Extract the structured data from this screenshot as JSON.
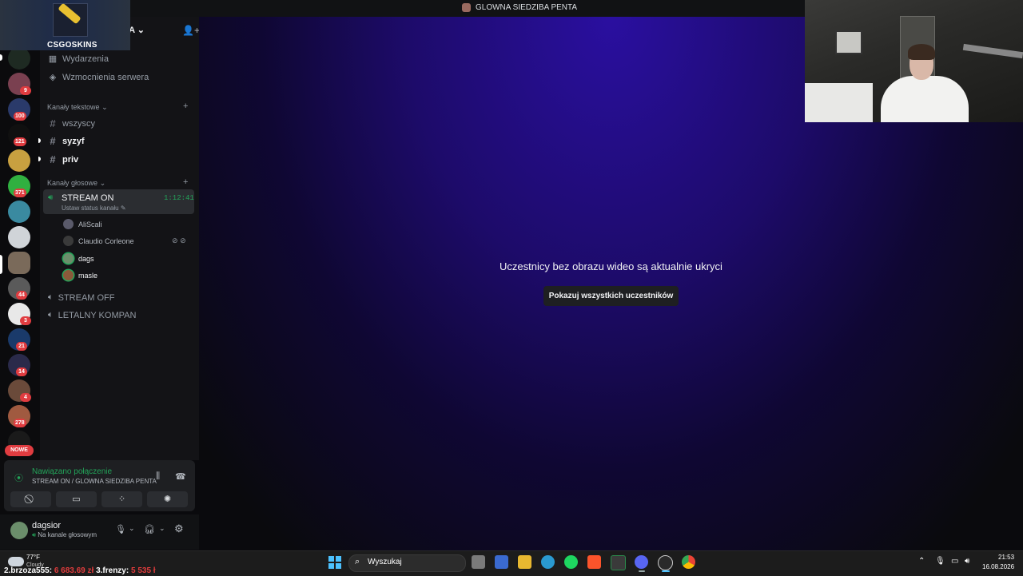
{
  "window": {
    "title": "GLOWNA SIEDZIBA PENTA"
  },
  "promo": {
    "brand": "CSGOSKINS"
  },
  "server": {
    "name_visible": "ENTA"
  },
  "server_rail": {
    "badges": [
      "9",
      "100",
      "121",
      "371",
      "44",
      "3",
      "21",
      "14",
      "4",
      "278"
    ],
    "new_label": "NOWE"
  },
  "sidebar": {
    "top_items": [
      {
        "label": "Wydarzenia",
        "icon": "calendar-icon"
      },
      {
        "label": "Wzmocnienia serwera",
        "icon": "boost-icon"
      }
    ],
    "text_category": "Kanały tekstowe",
    "text_channels": [
      {
        "name": "wszyscy",
        "unread": false
      },
      {
        "name": "syzyf",
        "unread": true
      },
      {
        "name": "priv",
        "unread": true
      }
    ],
    "voice_category": "Kanały głosowe",
    "active_voice": {
      "name": "STREAM ON",
      "timer": "1:12:41",
      "status": "Ustaw status kanału"
    },
    "members": [
      {
        "name": "AliScali",
        "active": false
      },
      {
        "name": "Claudio Corleone",
        "active": false
      },
      {
        "name": "dags",
        "active": true
      },
      {
        "name": "masle",
        "active": true
      }
    ],
    "other_voice": [
      "STREAM OFF",
      "LETALNY KOMPAN"
    ]
  },
  "voice_panel": {
    "status": "Nawiązano połączenie",
    "path": "STREAM ON / GLOWNA SIEDZIBA PENTA"
  },
  "user": {
    "name": "dagsior",
    "subtitle": "Na kanale głosowym"
  },
  "main": {
    "notice": "Uczestnicy bez obrazu wideo są aktualnie ukryci",
    "show_button": "Pokazuj wszystkich uczestników"
  },
  "taskbar": {
    "weather_temp": "77°F",
    "weather_desc": "Cloudy",
    "ticker_2_label": "2.brzoza555:",
    "ticker_2_value": "6 683.69 zł",
    "ticker_3_label": "3.frenzy:",
    "ticker_3_value": "5 535 ł",
    "search_placeholder": "Wyszukaj",
    "time": "21:53",
    "date": "16.08.2026"
  },
  "colors": {
    "accent_green": "#23a55a",
    "badge_red": "#e03c40",
    "main_gradient_top": "#2a0fa0"
  }
}
